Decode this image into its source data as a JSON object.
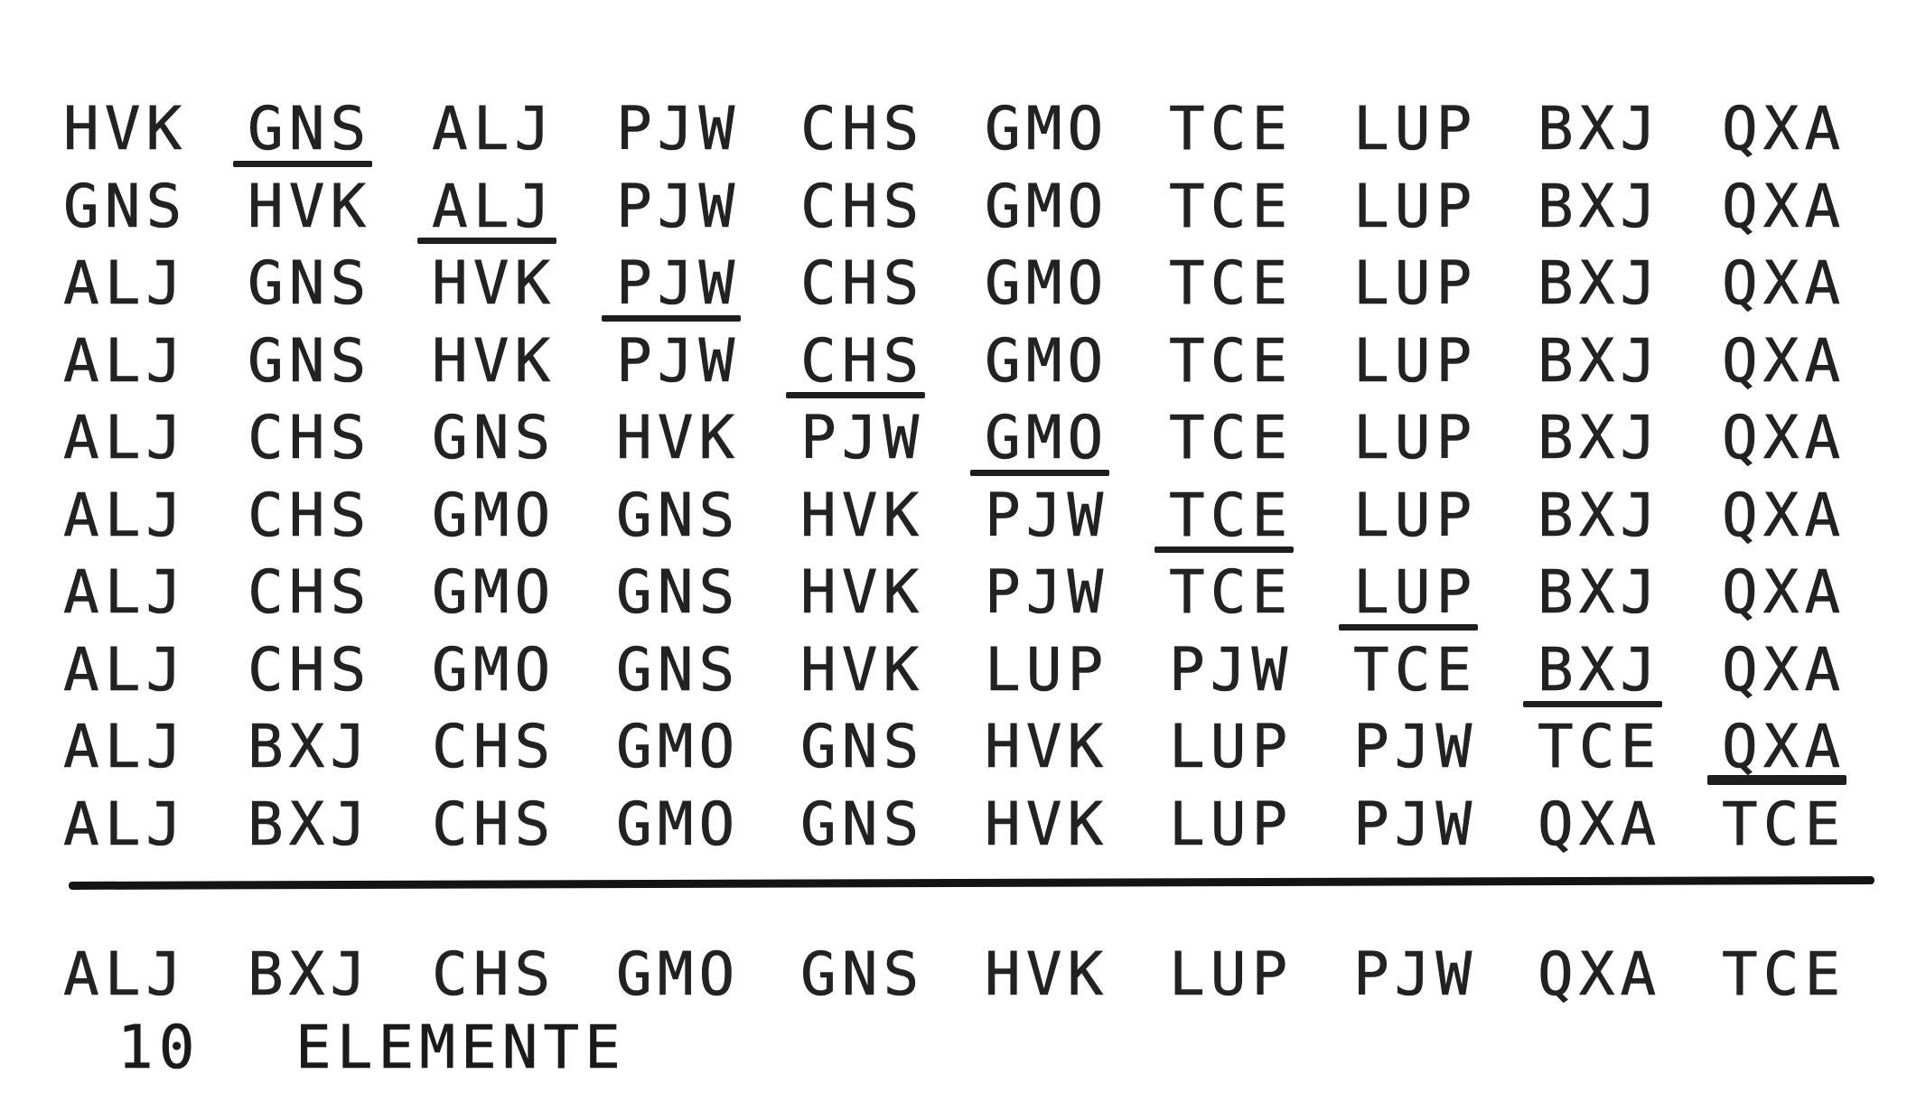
{
  "steps": [
    {
      "items": [
        "HVK",
        "GNS",
        "ALJ",
        "PJW",
        "CHS",
        "GMO",
        "TCE",
        "LUP",
        "BXJ",
        "QXA"
      ],
      "marked_index": 1
    },
    {
      "items": [
        "GNS",
        "HVK",
        "ALJ",
        "PJW",
        "CHS",
        "GMO",
        "TCE",
        "LUP",
        "BXJ",
        "QXA"
      ],
      "marked_index": 2
    },
    {
      "items": [
        "ALJ",
        "GNS",
        "HVK",
        "PJW",
        "CHS",
        "GMO",
        "TCE",
        "LUP",
        "BXJ",
        "QXA"
      ],
      "marked_index": 3
    },
    {
      "items": [
        "ALJ",
        "GNS",
        "HVK",
        "PJW",
        "CHS",
        "GMO",
        "TCE",
        "LUP",
        "BXJ",
        "QXA"
      ],
      "marked_index": 4
    },
    {
      "items": [
        "ALJ",
        "CHS",
        "GNS",
        "HVK",
        "PJW",
        "GMO",
        "TCE",
        "LUP",
        "BXJ",
        "QXA"
      ],
      "marked_index": 5
    },
    {
      "items": [
        "ALJ",
        "CHS",
        "GMO",
        "GNS",
        "HVK",
        "PJW",
        "TCE",
        "LUP",
        "BXJ",
        "QXA"
      ],
      "marked_index": 6
    },
    {
      "items": [
        "ALJ",
        "CHS",
        "GMO",
        "GNS",
        "HVK",
        "PJW",
        "TCE",
        "LUP",
        "BXJ",
        "QXA"
      ],
      "marked_index": 7
    },
    {
      "items": [
        "ALJ",
        "CHS",
        "GMO",
        "GNS",
        "HVK",
        "LUP",
        "PJW",
        "TCE",
        "BXJ",
        "QXA"
      ],
      "marked_index": 8
    },
    {
      "items": [
        "ALJ",
        "BXJ",
        "CHS",
        "GMO",
        "GNS",
        "HVK",
        "LUP",
        "PJW",
        "TCE",
        "QXA"
      ],
      "marked_index": 9
    },
    {
      "items": [
        "ALJ",
        "BXJ",
        "CHS",
        "GMO",
        "GNS",
        "HVK",
        "LUP",
        "PJW",
        "QXA",
        "TCE"
      ],
      "marked_index": null
    }
  ],
  "result": {
    "items": [
      "ALJ",
      "BXJ",
      "CHS",
      "GMO",
      "GNS",
      "HVK",
      "LUP",
      "PJW",
      "QXA",
      "TCE"
    ]
  },
  "footer": {
    "count": "10",
    "label": "ELEMENTE"
  },
  "colors": {
    "ink": "#1a1a1a",
    "paper": "#ffffff"
  }
}
